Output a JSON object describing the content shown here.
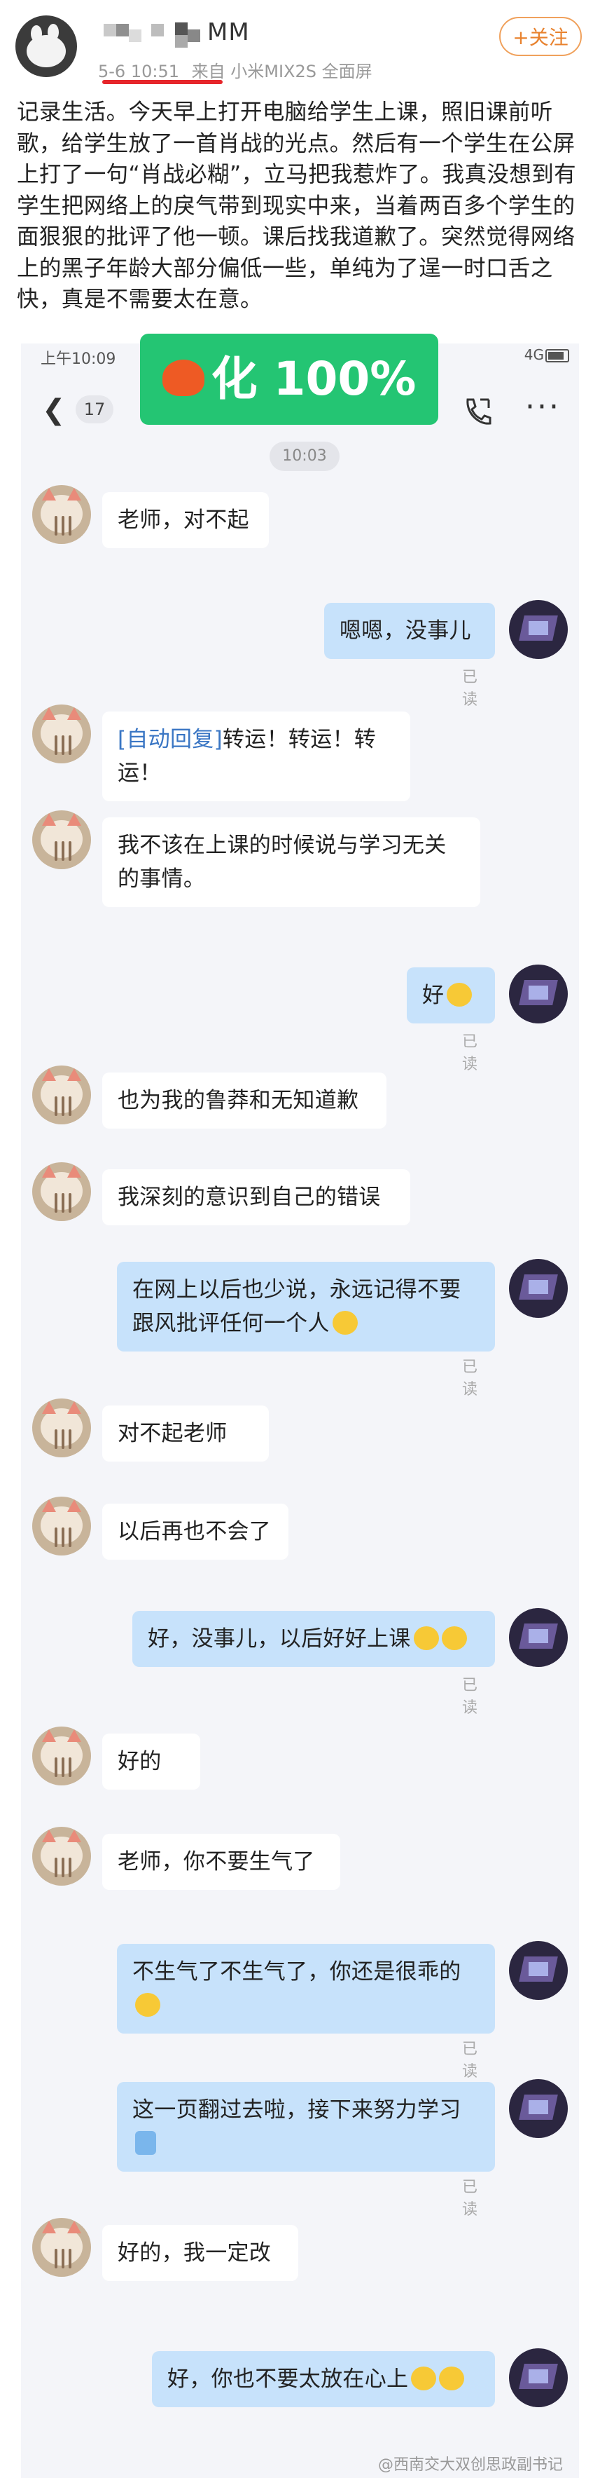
{
  "post": {
    "username_visible": "MM",
    "time": "5-6 10:51",
    "source": "来自 小米MIX2S 全面屏",
    "follow_label": "+关注",
    "text": "记录生活。今天早上打开电脑给学生上课，照旧课前听歌，给学生放了一首肖战的光点。然后有一个学生在公屏上打了一句“肖战必糊”，立马把我惹炸了。我真没想到有学生把网络上的戾气带到现实中来，当着两百多个学生的面狠狠的批评了他一顿。课后找我道歉了。突然觉得网络上的黑子年龄大部分偏低一些，单纯为了逞一时口舌之快，真是不需要太在意。"
  },
  "screenshot": {
    "status_time": "上午10:09",
    "status_right": "4G",
    "unread_count": "17",
    "chat_time": "10:03",
    "overlay_text": "化 100%",
    "read_label": "已读",
    "messages": [
      {
        "side": "left",
        "text": "老师，对不起"
      },
      {
        "side": "right",
        "text": "嗯嗯，没事儿"
      },
      {
        "side": "left",
        "tag": "[自动回复]",
        "text": "转运！转运！转运！"
      },
      {
        "side": "left",
        "text": "我不该在上课的时候说与学习无关的事情。"
      },
      {
        "side": "right",
        "text": "好"
      },
      {
        "side": "left",
        "text": "也为我的鲁莽和无知道歉"
      },
      {
        "side": "left",
        "text": "我深刻的意识到自己的错误"
      },
      {
        "side": "right",
        "text": "在网上以后也少说，永远记得不要跟风批评任何一个人"
      },
      {
        "side": "left",
        "text": "对不起老师"
      },
      {
        "side": "left",
        "text": "以后再也不会了"
      },
      {
        "side": "right",
        "text": "好，没事儿，以后好好上课"
      },
      {
        "side": "left",
        "text": "好的"
      },
      {
        "side": "left",
        "text": "老师，你不要生气了"
      },
      {
        "side": "right",
        "text": "不生气了不生气了，你还是很乖的"
      },
      {
        "side": "right",
        "text": "这一页翻过去啦，接下来努力学习"
      },
      {
        "side": "left",
        "text": "好的，我一定改"
      },
      {
        "side": "right",
        "text": "好，你也不要太放在心上"
      }
    ]
  },
  "watermark": "@西南交大双创思政副书记"
}
